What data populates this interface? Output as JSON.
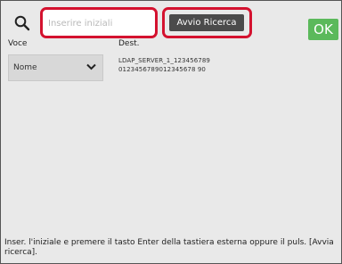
{
  "search": {
    "placeholder": "Inserire iniziali",
    "value": ""
  },
  "buttons": {
    "start_search": "Avvio Ricerca",
    "ok": "OK"
  },
  "columns": {
    "item": "Voce",
    "dest": "Dest."
  },
  "dropdown": {
    "selected": "Nome"
  },
  "server": {
    "line1": "LDAP_SERVER_1_123456789",
    "line2": "0123456789012345678 90"
  },
  "footer": {
    "message": "Inser. l'iniziale e premere il tasto Enter della tastiera esterna oppure il puls. [Avvia ricerca]."
  },
  "colors": {
    "highlight": "#d4122f",
    "ok": "#5bb95b",
    "button": "#4b4b4b"
  }
}
